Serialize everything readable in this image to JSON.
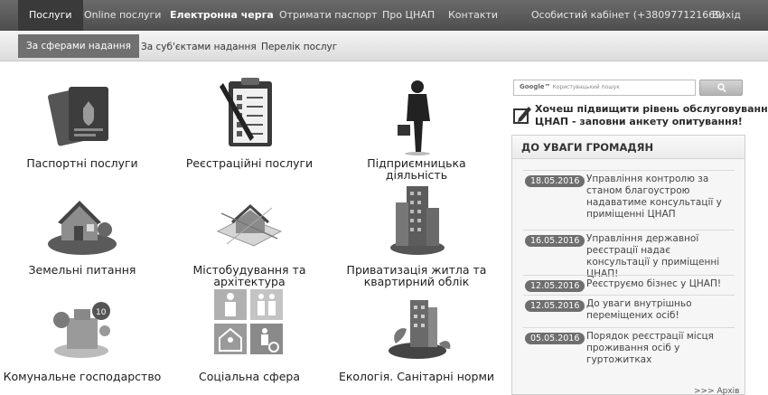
{
  "topnav": {
    "items": [
      {
        "label": "Послуги"
      },
      {
        "label": "Online послуги"
      },
      {
        "label": "Електронна черга"
      },
      {
        "label": "Отримати паспорт"
      },
      {
        "label": "Про ЦНАП"
      },
      {
        "label": "Контакти"
      },
      {
        "label": "Особистий кабінет (+380977121669)"
      },
      {
        "label": "Вихід"
      }
    ]
  },
  "subnav": {
    "items": [
      {
        "label": "За сферами надання"
      },
      {
        "label": "За суб'єктами надання"
      },
      {
        "label": "Перелік послуг"
      }
    ]
  },
  "services": [
    {
      "label": "Паспортні послуги",
      "icon": "passport-icon"
    },
    {
      "label": "Реєстраційні послуги",
      "icon": "clipboard-checklist-icon"
    },
    {
      "label": "Підприємницька діяльність",
      "icon": "businessman-icon"
    },
    {
      "label": "Земельні питання",
      "icon": "house-on-land-icon"
    },
    {
      "label": "Містобудування та архітектура",
      "icon": "architecture-plan-icon"
    },
    {
      "label": "Приватизація житла та квартирний облік",
      "icon": "apartment-building-icon"
    },
    {
      "label": "Комунальне господарство",
      "icon": "utilities-icon"
    },
    {
      "label": "Соціальна сфера",
      "icon": "social-family-icon"
    },
    {
      "label": "Екологія. Санітарні норми",
      "icon": "ecology-building-icon"
    }
  ],
  "search": {
    "brand": "Google™",
    "placeholder": "Користувацький пошук"
  },
  "survey": {
    "line1": "Хочеш підвищити рівень обслуговування",
    "line2": "ЦНАП - заповни анкету опитування!"
  },
  "news": {
    "heading": "ДО УВАГИ ГРОМАДЯН",
    "items": [
      {
        "date": "18.05.2016",
        "title": "Управління контролю за станом благоустрою надаватиме консультації у приміщенні ЦНАП"
      },
      {
        "date": "16.05.2016",
        "title": "Управління державної реєстрації надає консультації у приміщенні ЦНАП!"
      },
      {
        "date": "12.05.2016",
        "title": "Реєструємо бізнес у ЦНАП!"
      },
      {
        "date": "12.05.2016",
        "title": "До уваги внутрішньо переміщених осіб!"
      },
      {
        "date": "05.05.2016",
        "title": "Порядок реєстрації місця проживання осіб у гуртожитках"
      }
    ],
    "archive": ">>> Архів"
  }
}
